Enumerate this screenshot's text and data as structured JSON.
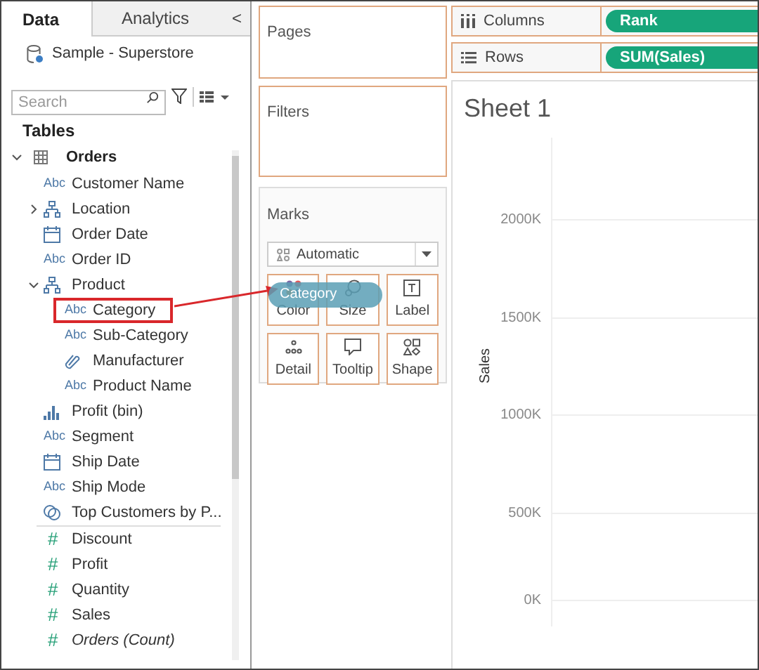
{
  "sidebar": {
    "tabs": [
      {
        "label": "Data",
        "selected": true
      },
      {
        "label": "Analytics",
        "selected": false
      }
    ],
    "collapse": "<",
    "datasource": "Sample - Superstore",
    "search": {
      "placeholder": "Search"
    },
    "section_title": "Tables",
    "table": {
      "name": "Orders",
      "expanded": true
    },
    "fields": [
      {
        "kind": "abc",
        "badge": "Abc",
        "label": "Customer Name",
        "highlighted": false
      },
      {
        "kind": "hierarchy",
        "label": "Location",
        "expanded": false,
        "highlighted": false
      },
      {
        "kind": "date",
        "label": "Order Date",
        "highlighted": false
      },
      {
        "kind": "abc",
        "badge": "Abc",
        "label": "Order ID",
        "highlighted": false
      },
      {
        "kind": "hierarchy",
        "label": "Product",
        "expanded": true,
        "highlighted": false,
        "children": [
          {
            "kind": "abc",
            "badge": "Abc",
            "label": "Category",
            "highlighted": true
          },
          {
            "kind": "abc",
            "badge": "Abc",
            "label": "Sub-Category",
            "highlighted": false
          },
          {
            "kind": "attachment",
            "label": "Manufacturer",
            "highlighted": false
          },
          {
            "kind": "abc",
            "badge": "Abc",
            "label": "Product Name",
            "highlighted": false
          }
        ]
      },
      {
        "kind": "bin",
        "label": "Profit (bin)",
        "highlighted": false
      },
      {
        "kind": "abc",
        "badge": "Abc",
        "label": "Segment",
        "highlighted": false
      },
      {
        "kind": "date",
        "label": "Ship Date",
        "highlighted": false
      },
      {
        "kind": "abc",
        "badge": "Abc",
        "label": "Ship Mode",
        "highlighted": false
      },
      {
        "kind": "set",
        "label": "Top Customers by P...",
        "highlighted": false
      },
      {
        "kind": "measure",
        "badge": "#",
        "label": "Discount",
        "highlighted": false,
        "italic": false
      },
      {
        "kind": "measure",
        "badge": "#",
        "label": "Profit",
        "highlighted": false,
        "italic": false
      },
      {
        "kind": "measure",
        "badge": "#",
        "label": "Quantity",
        "highlighted": false,
        "italic": false
      },
      {
        "kind": "measure",
        "badge": "#",
        "label": "Sales",
        "highlighted": false,
        "italic": false
      },
      {
        "kind": "measure",
        "badge": "#",
        "label": "Orders (Count)",
        "highlighted": false,
        "italic": true
      }
    ]
  },
  "pages": {
    "title": "Pages"
  },
  "filters": {
    "title": "Filters"
  },
  "marks": {
    "title": "Marks",
    "mark_type": "Automatic",
    "buttons": [
      {
        "kind": "color",
        "label": "Color"
      },
      {
        "kind": "size",
        "label": "Size"
      },
      {
        "kind": "label",
        "label": "Label"
      },
      {
        "kind": "detail",
        "label": "Detail"
      },
      {
        "kind": "tooltip",
        "label": "Tooltip"
      },
      {
        "kind": "shape",
        "label": "Shape"
      }
    ]
  },
  "shelves": [
    {
      "kind": "columns",
      "label": "Columns",
      "pill": "Rank"
    },
    {
      "kind": "rows",
      "label": "Rows",
      "pill": "SUM(Sales)"
    }
  ],
  "sheet": {
    "title": "Sheet 1",
    "axis_title": "Sales",
    "ticks": [
      "2000K",
      "1500K",
      "1000K",
      "500K",
      "0K"
    ]
  },
  "drag_pill": "Category"
}
